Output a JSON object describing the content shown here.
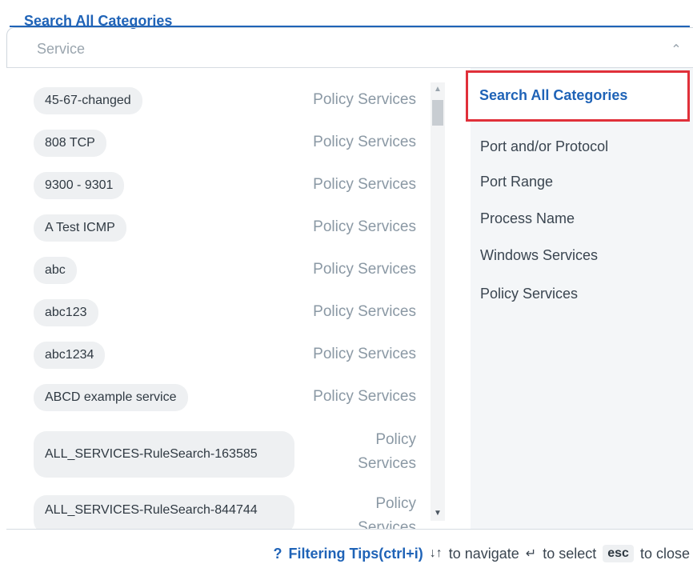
{
  "header": {
    "legend": "Search All Categories",
    "input_value": "Service"
  },
  "list": {
    "items": [
      {
        "name": "45-67-changed",
        "category": "Policy Services"
      },
      {
        "name": "808 TCP",
        "category": "Policy Services"
      },
      {
        "name": "9300 - 9301",
        "category": "Policy Services"
      },
      {
        "name": "A Test ICMP",
        "category": "Policy Services"
      },
      {
        "name": "abc",
        "category": "Policy Services"
      },
      {
        "name": "abc123",
        "category": "Policy Services"
      },
      {
        "name": "abc1234",
        "category": "Policy Services"
      },
      {
        "name": "ABCD example service",
        "category": "Policy Services"
      },
      {
        "name": "ALL_SERVICES-RuleSearch-163585",
        "category_line1": "Policy",
        "category_line2": "Services"
      },
      {
        "name": "ALL_SERVICES-RuleSearch-844744",
        "category_line1": "Policy",
        "category_line2": "Services"
      }
    ]
  },
  "categories": {
    "selected": "Search All Categories",
    "items": [
      "Port and/or Protocol",
      "Port Range",
      "Process Name",
      "Windows Services",
      "Policy Services"
    ]
  },
  "footer": {
    "tips_icon": "?",
    "tips_label": "Filtering Tips(ctrl+i)",
    "navigate_icon": "↓↑",
    "navigate_label": "to navigate",
    "select_icon": "↵",
    "select_label": "to select",
    "esc_key": "esc",
    "close_label": "to close"
  },
  "colors": {
    "accent": "#1f63b7",
    "highlight_border": "#e0303a"
  }
}
